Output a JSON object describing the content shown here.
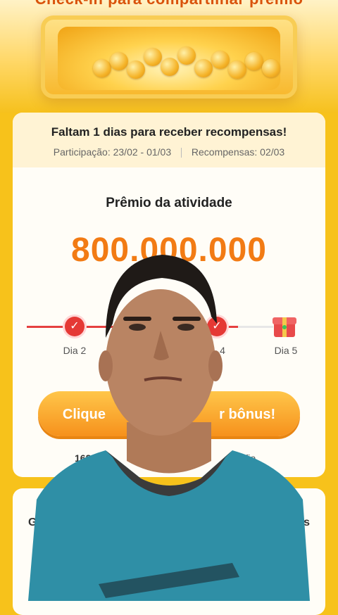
{
  "hero": {
    "title": "Check-in para compartilhar prêmio"
  },
  "card": {
    "countdown": "Faltam 1 dias para receber recompensas!",
    "participation": "Participação: 23/02 - 01/03",
    "rewards_date": "Recompensas: 02/03",
    "prize_label": "Prêmio da atividade",
    "prize_amount": "800.000.000",
    "days": [
      "Dia 2",
      "4",
      "Dia 5"
    ],
    "claim_button": "Clique para receber bônus!",
    "claim_button_visible": "Clique",
    "claim_button_visible_right": "r bônus!",
    "footer_left": "168.0",
    "footer_right": "desafio"
  },
  "card2": {
    "left_text": "G",
    "right_text": "es"
  },
  "colors": {
    "accent": "#f27b14",
    "button": "#f6911c",
    "progress": "#e53935",
    "background": "#f7c21b"
  }
}
